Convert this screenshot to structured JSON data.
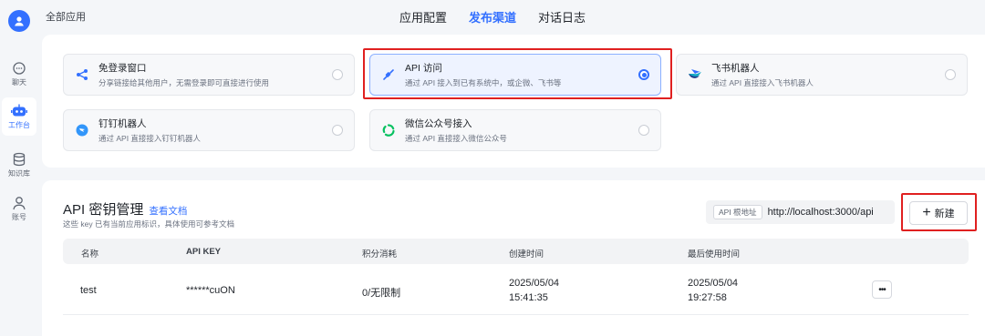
{
  "breadcrumb": "全部应用",
  "top_tabs": [
    {
      "label": "应用配置",
      "active": false
    },
    {
      "label": "发布渠道",
      "active": true
    },
    {
      "label": "对话日志",
      "active": false
    }
  ],
  "sidebar": {
    "items": [
      {
        "label": "聊天",
        "icon": "chat-icon",
        "active": false
      },
      {
        "label": "工作台",
        "icon": "robot-icon",
        "active": true
      },
      {
        "label": "知识库",
        "icon": "database-icon",
        "active": false
      },
      {
        "label": "账号",
        "icon": "user-icon",
        "active": false
      }
    ]
  },
  "channels": [
    {
      "title": "免登录窗口",
      "desc": "分享链接给其他用户，无需登录即可直接进行使用",
      "icon": "share-icon",
      "selected": false
    },
    {
      "title": "API 访问",
      "desc": "通过 API 接入到已有系统中，或企微、飞书等",
      "icon": "api-icon",
      "selected": true
    },
    {
      "title": "飞书机器人",
      "desc": "通过 API 直接接入飞书机器人",
      "icon": "feishu-icon",
      "selected": false
    },
    {
      "title": "钉钉机器人",
      "desc": "通过 API 直接接入钉钉机器人",
      "icon": "dingtalk-icon",
      "selected": false
    },
    {
      "title": "微信公众号接入",
      "desc": "通过 API 直接接入微信公众号",
      "icon": "wechat-icon",
      "selected": false
    }
  ],
  "api_keys": {
    "title": "API 密钥管理",
    "doc_link": "查看文档",
    "subtitle": "这些 key 已有当前应用标识，具体使用可参考文档",
    "root_label": "API 根地址",
    "root_url": "http://localhost:3000/api",
    "new_button": "新建",
    "columns": [
      "名称",
      "API KEY",
      "积分消耗",
      "创建时间",
      "最后使用时间"
    ],
    "rows": [
      {
        "name": "test",
        "key": "******cuON",
        "usage": "0/无限制",
        "created_date": "2025/05/04",
        "created_time": "15:41:35",
        "last_date": "2025/05/04",
        "last_time": "19:27:58"
      }
    ],
    "more_label": "•••"
  },
  "colors": {
    "accent": "#3370ff",
    "highlight": "#e02020"
  }
}
